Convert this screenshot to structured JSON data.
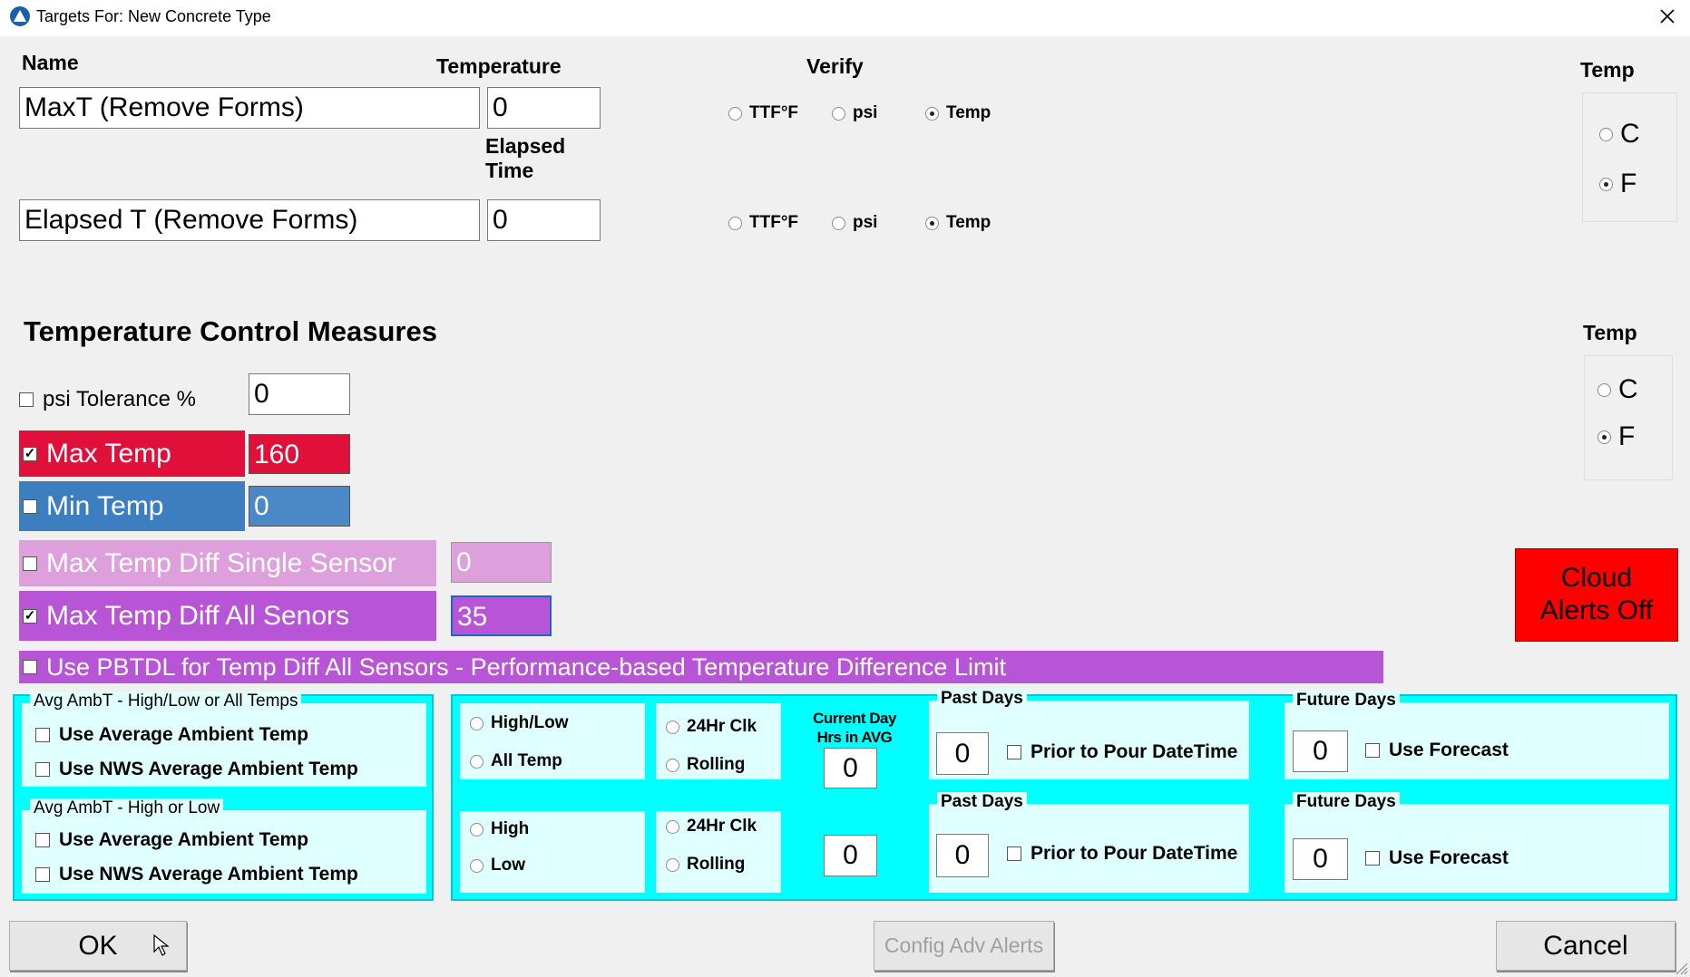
{
  "window": {
    "title": "Targets For: New Concrete Type",
    "close_icon": "close-icon",
    "app_icon": "app-logo-icon"
  },
  "targets": {
    "name_label": "Name",
    "temperature_label": "Temperature",
    "verify_label": "Verify",
    "elapsed_label_1": "Elapsed",
    "elapsed_label_2": "Time",
    "rows": [
      {
        "name": "MaxT (Remove Forms)",
        "value": "0",
        "options": [
          "TTF°F",
          "psi",
          "Temp"
        ],
        "selected": "Temp"
      },
      {
        "name": "Elapsed T (Remove Forms)",
        "value": "0",
        "options": [
          "TTF°F",
          "psi",
          "Temp"
        ],
        "selected": "Temp"
      }
    ],
    "temp_unit": {
      "label": "Temp",
      "options": [
        "C",
        "F"
      ],
      "selected": "F"
    }
  },
  "measures": {
    "heading": "Temperature Control Measures",
    "temp_unit": {
      "label": "Temp",
      "options": [
        "C",
        "F"
      ],
      "selected": "F"
    },
    "psi_tolerance": {
      "label": "psi Tolerance %",
      "checked": false,
      "value": "0"
    },
    "max_temp": {
      "label": "Max Temp",
      "checked": true,
      "value": "160",
      "color": "#e0103a"
    },
    "min_temp": {
      "label": "Min Temp",
      "checked": false,
      "value": "0",
      "color": "#3d7ec0"
    },
    "max_diff_single": {
      "label": "Max Temp Diff Single Sensor",
      "checked": false,
      "value": "0",
      "color": "#dda0dd"
    },
    "max_diff_all": {
      "label": "Max Temp Diff All Senors",
      "checked": true,
      "value": "35",
      "color": "#b855d6"
    },
    "pbtdl": {
      "label": "Use PBTDL for Temp Diff All Sensors - Performance-based Temperature Difference Limit",
      "checked": false
    },
    "cloud_alerts": {
      "label_1": "Cloud",
      "label_2": "Alerts Off",
      "color": "#ff0000"
    }
  },
  "ambient": {
    "group1": {
      "title": "Avg AmbT - High/Low or All Temps",
      "options": [
        "Use Average Ambient Temp",
        "Use NWS Average Ambient Temp"
      ]
    },
    "group2": {
      "title": "Avg AmbT - High or Low",
      "options": [
        "Use Average Ambient Temp",
        "Use NWS Average Ambient Temp"
      ]
    },
    "row1": {
      "mode": [
        "High/Low",
        "All Temp"
      ],
      "clock": [
        "24Hr Clk",
        "Rolling"
      ],
      "hrs": "0",
      "past_title": "Past Days",
      "past": "0",
      "prior": "Prior to Pour DateTime",
      "future_title": "Future Days",
      "future": "0",
      "forecast": "Use Forecast"
    },
    "row2": {
      "mode": [
        "High",
        "Low"
      ],
      "clock": [
        "24Hr Clk",
        "Rolling"
      ],
      "hrs": "0",
      "past_title": "Past Days",
      "past": "0",
      "prior": "Prior to Pour DateTime",
      "future_title": "Future Days",
      "future": "0",
      "forecast": "Use Forecast"
    },
    "current_day_1": "Current Day",
    "current_day_2": "Hrs in AVG",
    "panel_color": "#00ffff"
  },
  "buttons": {
    "ok": "OK",
    "config": "Config Adv Alerts",
    "cancel": "Cancel"
  }
}
